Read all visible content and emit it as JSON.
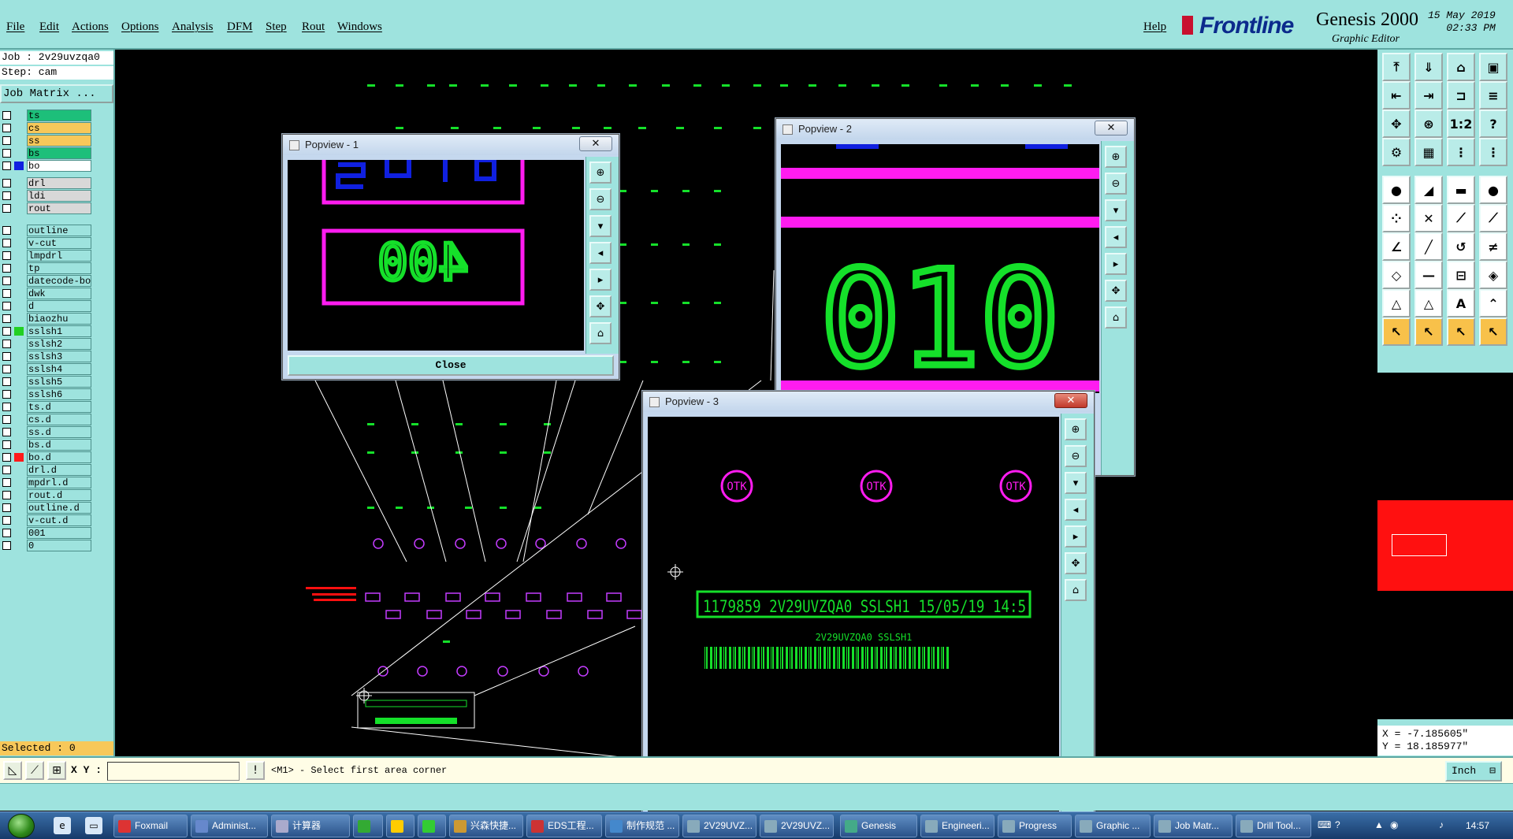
{
  "menu": {
    "items": [
      "File",
      "Edit",
      "Actions",
      "Options",
      "Analysis",
      "DFM",
      "Step",
      "Rout",
      "Windows"
    ],
    "help": "Help"
  },
  "brand": {
    "logo": "Frontline",
    "product": "Genesis 2000",
    "subtitle": "Graphic Editor",
    "date": "15 May 2019",
    "time": "02:33 PM"
  },
  "job": {
    "job_line": "Job : 2v29uvzqa0",
    "step_line": "Step: cam",
    "matrix_button": "Job Matrix ...",
    "selected": "Selected : 0"
  },
  "layers": [
    {
      "name": "ts",
      "bg": "#1dbf7a",
      "swatch": ""
    },
    {
      "name": "cs",
      "bg": "#f7c85a",
      "swatch": ""
    },
    {
      "name": "ss",
      "bg": "#f7c85a",
      "swatch": ""
    },
    {
      "name": "bs",
      "bg": "#1dbf7a",
      "swatch": ""
    },
    {
      "name": "bo",
      "bg": "#ffffff",
      "swatch": "#1020e0"
    },
    {
      "name": "drl",
      "bg": "#d8d8d8",
      "swatch": ""
    },
    {
      "name": "ldi",
      "bg": "#d8d8d8",
      "swatch": ""
    },
    {
      "name": "rout",
      "bg": "#d8d8d8",
      "swatch": ""
    },
    {
      "name": "outline",
      "bg": "#9ee3de",
      "swatch": ""
    },
    {
      "name": "v-cut",
      "bg": "#9ee3de",
      "swatch": ""
    },
    {
      "name": "lmpdrl",
      "bg": "#9ee3de",
      "swatch": ""
    },
    {
      "name": "tp",
      "bg": "#9ee3de",
      "swatch": ""
    },
    {
      "name": "datecode-bo",
      "bg": "#9ee3de",
      "swatch": ""
    },
    {
      "name": "dwk",
      "bg": "#9ee3de",
      "swatch": ""
    },
    {
      "name": "d",
      "bg": "#9ee3de",
      "swatch": ""
    },
    {
      "name": "biaozhu",
      "bg": "#9ee3de",
      "swatch": ""
    },
    {
      "name": "sslsh1",
      "bg": "#9ee3de",
      "swatch": "#22d022"
    },
    {
      "name": "sslsh2",
      "bg": "#9ee3de",
      "swatch": ""
    },
    {
      "name": "sslsh3",
      "bg": "#9ee3de",
      "swatch": ""
    },
    {
      "name": "sslsh4",
      "bg": "#9ee3de",
      "swatch": ""
    },
    {
      "name": "sslsh5",
      "bg": "#9ee3de",
      "swatch": ""
    },
    {
      "name": "sslsh6",
      "bg": "#9ee3de",
      "swatch": ""
    },
    {
      "name": "ts.d",
      "bg": "#9ee3de",
      "swatch": ""
    },
    {
      "name": "cs.d",
      "bg": "#9ee3de",
      "swatch": ""
    },
    {
      "name": "ss.d",
      "bg": "#9ee3de",
      "swatch": ""
    },
    {
      "name": "bs.d",
      "bg": "#9ee3de",
      "swatch": ""
    },
    {
      "name": "bo.d",
      "bg": "#9ee3de",
      "swatch": "#ff1a1a"
    },
    {
      "name": "drl.d",
      "bg": "#9ee3de",
      "swatch": ""
    },
    {
      "name": "mpdrl.d",
      "bg": "#9ee3de",
      "swatch": ""
    },
    {
      "name": "rout.d",
      "bg": "#9ee3de",
      "swatch": ""
    },
    {
      "name": "outline.d",
      "bg": "#9ee3de",
      "swatch": ""
    },
    {
      "name": "v-cut.d",
      "bg": "#9ee3de",
      "swatch": ""
    },
    {
      "name": "001",
      "bg": "#9ee3de",
      "swatch": ""
    },
    {
      "name": "0",
      "bg": "#9ee3de",
      "swatch": ""
    }
  ],
  "coords": {
    "x": "X = -7.185605\"",
    "y": "Y = 18.185977\""
  },
  "command": {
    "xy_label": "X Y :",
    "xy_value": "",
    "prompt": "<M1> - Select first area corner",
    "unit": "Inch"
  },
  "popviews": {
    "p1": {
      "title": "Popview - 1",
      "close_label": "Close",
      "text": "400"
    },
    "p2": {
      "title": "Popview - 2",
      "text": "010"
    },
    "p3": {
      "title": "Popview - 3",
      "marks": [
        "OTK",
        "OTK",
        "OTK"
      ],
      "serial": "1179859 2V29UVZQA0 SSLSH1 15/05/19 14:5",
      "caption": "2V29UVZQA0 SSLSH1"
    }
  },
  "taskbar": {
    "items": [
      "Foxmail",
      "Administ...",
      "计算器",
      "",
      "",
      "",
      "兴森快捷...",
      "EDS工程...",
      "制作规范 ...",
      "2V29UVZ...",
      "2V29UVZ...",
      "Genesis",
      "Engineeri...",
      "Progress",
      "Graphic ...",
      "Job Matr...",
      "Drill Tool..."
    ],
    "clock": "14:57"
  },
  "colors": {
    "panel": "#9ee3de",
    "magenta": "#ff1cf0",
    "green": "#15e02a",
    "blue": "#1020e0",
    "red": "#ff1010"
  }
}
